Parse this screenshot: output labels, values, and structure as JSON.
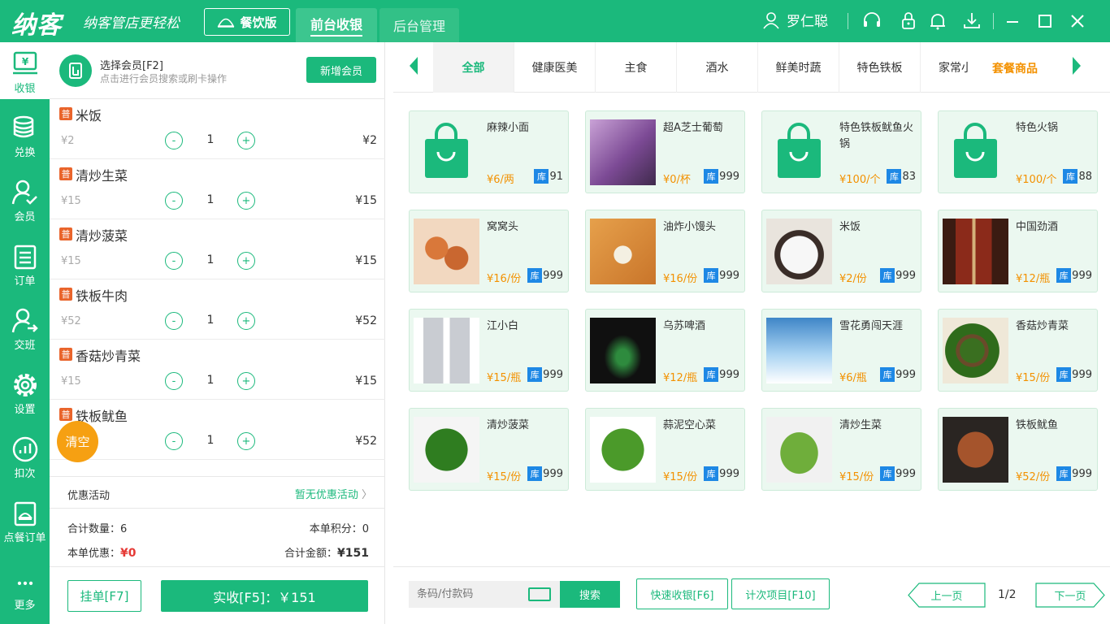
{
  "app": {
    "logo": "纳客",
    "slogan": "纳客管店更轻松",
    "edition": "餐饮版",
    "tabs": [
      "前台收银",
      "后台管理"
    ],
    "user": "罗仁聪"
  },
  "sidebar": [
    {
      "label": "收银",
      "icon": "cash-register-icon"
    },
    {
      "label": "兑换",
      "icon": "coins-icon"
    },
    {
      "label": "会员",
      "icon": "member-icon"
    },
    {
      "label": "订单",
      "icon": "order-icon"
    },
    {
      "label": "交班",
      "icon": "shift-icon"
    },
    {
      "label": "设置",
      "icon": "gear-icon"
    },
    {
      "label": "扣次",
      "icon": "chart-icon"
    },
    {
      "label": "点餐订单",
      "icon": "dining-order-icon"
    },
    {
      "label": "更多",
      "icon": "more-icon"
    }
  ],
  "member": {
    "title": "选择会员[F2]",
    "subtitle": "点击进行会员搜索或刷卡操作",
    "add_button": "新增会员"
  },
  "order_items": [
    {
      "badge": "普",
      "name": "米饭",
      "price": "¥2",
      "qty": "1",
      "total": "¥2"
    },
    {
      "badge": "普",
      "name": "清炒生菜",
      "price": "¥15",
      "qty": "1",
      "total": "¥15"
    },
    {
      "badge": "普",
      "name": "清炒菠菜",
      "price": "¥15",
      "qty": "1",
      "total": "¥15"
    },
    {
      "badge": "普",
      "name": "铁板牛肉",
      "price": "¥52",
      "qty": "1",
      "total": "¥52"
    },
    {
      "badge": "普",
      "name": "香菇炒青菜",
      "price": "¥15",
      "qty": "1",
      "total": "¥15"
    },
    {
      "badge": "普",
      "name": "铁板鱿鱼",
      "price": "¥52",
      "qty": "1",
      "total": "¥52"
    }
  ],
  "qty_minus": "-",
  "qty_plus": "+",
  "clear_button": "清空",
  "promo": {
    "label": "优惠活动",
    "value": "暂无优惠活动"
  },
  "summary": {
    "count_label": "合计数量：",
    "count": "6",
    "points_label": "本单积分：",
    "points": "0",
    "discount_label": "本单优惠：",
    "discount": "¥0",
    "amount_label": "合计金额：",
    "amount": "¥151"
  },
  "hold_button": "挂单[F7]",
  "pay_button": "实收[F5]：￥151",
  "categories": [
    "全部",
    "健康医美",
    "主食",
    "酒水",
    "鲜美时蔬",
    "特色铁板",
    "家常小炒"
  ],
  "category_extra": "套餐商品",
  "stock_badge": "库",
  "products": [
    {
      "name": "麻辣小面",
      "price": "¥6/两",
      "stock": "91",
      "img": "bag"
    },
    {
      "name": "超A芝士葡萄",
      "price": "¥0/杯",
      "stock": "999",
      "img": "grape"
    },
    {
      "name": "特色铁板鱿鱼火锅",
      "price": "¥100/个",
      "stock": "83",
      "img": "bag"
    },
    {
      "name": "特色火锅",
      "price": "¥100/个",
      "stock": "88",
      "img": "bag"
    },
    {
      "name": "窝窝头",
      "price": "¥16/份",
      "stock": "999",
      "img": "wotou"
    },
    {
      "name": "油炸小馒头",
      "price": "¥16/份",
      "stock": "999",
      "img": "mantou"
    },
    {
      "name": "米饭",
      "price": "¥2/份",
      "stock": "999",
      "img": "rice"
    },
    {
      "name": "中国劲酒",
      "price": "¥12/瓶",
      "stock": "999",
      "img": "jinjiu"
    },
    {
      "name": "江小白",
      "price": "¥15/瓶",
      "stock": "999",
      "img": "jiangxiaobai"
    },
    {
      "name": "乌苏啤酒",
      "price": "¥12/瓶",
      "stock": "999",
      "img": "wusu"
    },
    {
      "name": "雪花勇闯天涯",
      "price": "¥6/瓶",
      "stock": "999",
      "img": "snow"
    },
    {
      "name": "香菇炒青菜",
      "price": "¥15/份",
      "stock": "999",
      "img": "greens"
    },
    {
      "name": "清炒菠菜",
      "price": "¥15/份",
      "stock": "999",
      "img": "spinach"
    },
    {
      "name": "蒜泥空心菜",
      "price": "¥15/份",
      "stock": "999",
      "img": "kongxin"
    },
    {
      "name": "清炒生菜",
      "price": "¥15/份",
      "stock": "999",
      "img": "lettuce"
    },
    {
      "name": "铁板鱿鱼",
      "price": "¥52/份",
      "stock": "999",
      "img": "squid"
    }
  ],
  "search": {
    "placeholder": "条码/付款码",
    "button": "搜索"
  },
  "quick_cash_button": "快速收银[F6]",
  "count_item_button": "计次项目[F10]",
  "pagination": {
    "prev": "上一页",
    "next": "下一页",
    "page": "1/2"
  },
  "colors": {
    "brand": "#1bb97c",
    "accent": "#f39100",
    "clear": "#f6a012",
    "badge": "#e9642b",
    "stock": "#1e88e5"
  }
}
